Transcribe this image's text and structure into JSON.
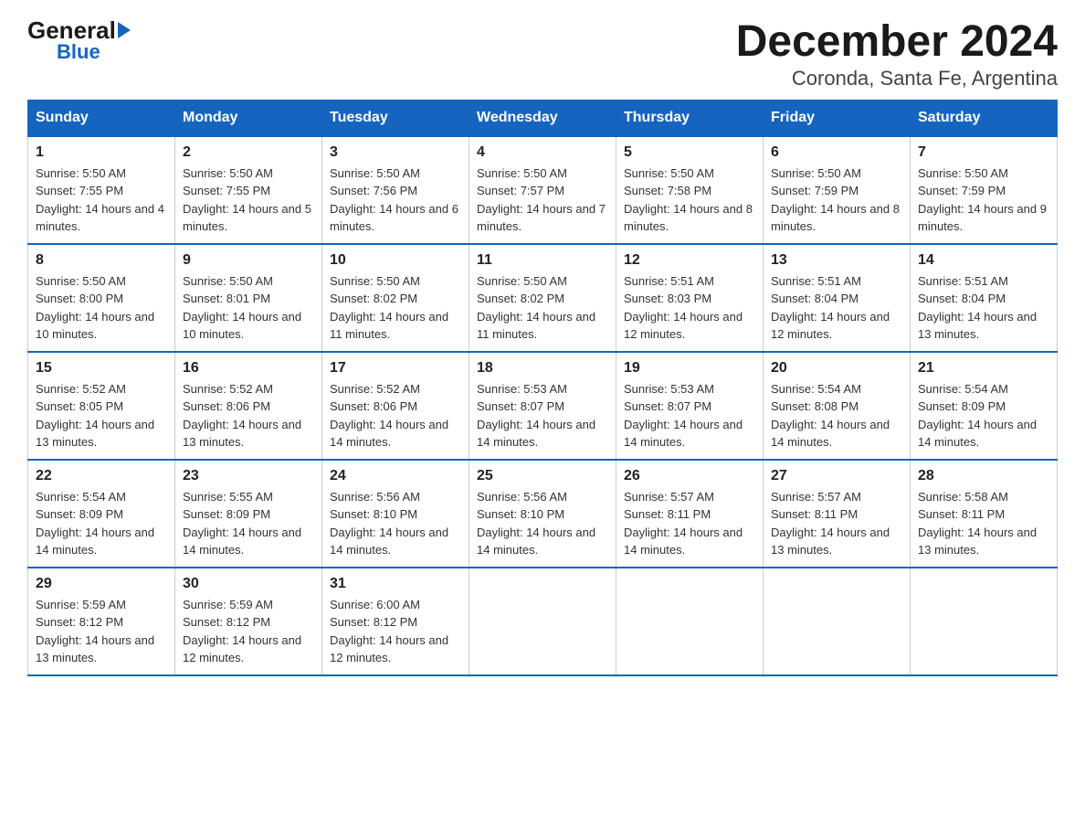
{
  "logo": {
    "general": "General",
    "blue": "Blue",
    "triangle": "▼"
  },
  "title": "December 2024",
  "subtitle": "Coronda, Santa Fe, Argentina",
  "days_of_week": [
    "Sunday",
    "Monday",
    "Tuesday",
    "Wednesday",
    "Thursday",
    "Friday",
    "Saturday"
  ],
  "weeks": [
    [
      {
        "num": "1",
        "sunrise": "5:50 AM",
        "sunset": "7:55 PM",
        "daylight": "14 hours and 4 minutes."
      },
      {
        "num": "2",
        "sunrise": "5:50 AM",
        "sunset": "7:55 PM",
        "daylight": "14 hours and 5 minutes."
      },
      {
        "num": "3",
        "sunrise": "5:50 AM",
        "sunset": "7:56 PM",
        "daylight": "14 hours and 6 minutes."
      },
      {
        "num": "4",
        "sunrise": "5:50 AM",
        "sunset": "7:57 PM",
        "daylight": "14 hours and 7 minutes."
      },
      {
        "num": "5",
        "sunrise": "5:50 AM",
        "sunset": "7:58 PM",
        "daylight": "14 hours and 8 minutes."
      },
      {
        "num": "6",
        "sunrise": "5:50 AM",
        "sunset": "7:59 PM",
        "daylight": "14 hours and 8 minutes."
      },
      {
        "num": "7",
        "sunrise": "5:50 AM",
        "sunset": "7:59 PM",
        "daylight": "14 hours and 9 minutes."
      }
    ],
    [
      {
        "num": "8",
        "sunrise": "5:50 AM",
        "sunset": "8:00 PM",
        "daylight": "14 hours and 10 minutes."
      },
      {
        "num": "9",
        "sunrise": "5:50 AM",
        "sunset": "8:01 PM",
        "daylight": "14 hours and 10 minutes."
      },
      {
        "num": "10",
        "sunrise": "5:50 AM",
        "sunset": "8:02 PM",
        "daylight": "14 hours and 11 minutes."
      },
      {
        "num": "11",
        "sunrise": "5:50 AM",
        "sunset": "8:02 PM",
        "daylight": "14 hours and 11 minutes."
      },
      {
        "num": "12",
        "sunrise": "5:51 AM",
        "sunset": "8:03 PM",
        "daylight": "14 hours and 12 minutes."
      },
      {
        "num": "13",
        "sunrise": "5:51 AM",
        "sunset": "8:04 PM",
        "daylight": "14 hours and 12 minutes."
      },
      {
        "num": "14",
        "sunrise": "5:51 AM",
        "sunset": "8:04 PM",
        "daylight": "14 hours and 13 minutes."
      }
    ],
    [
      {
        "num": "15",
        "sunrise": "5:52 AM",
        "sunset": "8:05 PM",
        "daylight": "14 hours and 13 minutes."
      },
      {
        "num": "16",
        "sunrise": "5:52 AM",
        "sunset": "8:06 PM",
        "daylight": "14 hours and 13 minutes."
      },
      {
        "num": "17",
        "sunrise": "5:52 AM",
        "sunset": "8:06 PM",
        "daylight": "14 hours and 14 minutes."
      },
      {
        "num": "18",
        "sunrise": "5:53 AM",
        "sunset": "8:07 PM",
        "daylight": "14 hours and 14 minutes."
      },
      {
        "num": "19",
        "sunrise": "5:53 AM",
        "sunset": "8:07 PM",
        "daylight": "14 hours and 14 minutes."
      },
      {
        "num": "20",
        "sunrise": "5:54 AM",
        "sunset": "8:08 PM",
        "daylight": "14 hours and 14 minutes."
      },
      {
        "num": "21",
        "sunrise": "5:54 AM",
        "sunset": "8:09 PM",
        "daylight": "14 hours and 14 minutes."
      }
    ],
    [
      {
        "num": "22",
        "sunrise": "5:54 AM",
        "sunset": "8:09 PM",
        "daylight": "14 hours and 14 minutes."
      },
      {
        "num": "23",
        "sunrise": "5:55 AM",
        "sunset": "8:09 PM",
        "daylight": "14 hours and 14 minutes."
      },
      {
        "num": "24",
        "sunrise": "5:56 AM",
        "sunset": "8:10 PM",
        "daylight": "14 hours and 14 minutes."
      },
      {
        "num": "25",
        "sunrise": "5:56 AM",
        "sunset": "8:10 PM",
        "daylight": "14 hours and 14 minutes."
      },
      {
        "num": "26",
        "sunrise": "5:57 AM",
        "sunset": "8:11 PM",
        "daylight": "14 hours and 14 minutes."
      },
      {
        "num": "27",
        "sunrise": "5:57 AM",
        "sunset": "8:11 PM",
        "daylight": "14 hours and 13 minutes."
      },
      {
        "num": "28",
        "sunrise": "5:58 AM",
        "sunset": "8:11 PM",
        "daylight": "14 hours and 13 minutes."
      }
    ],
    [
      {
        "num": "29",
        "sunrise": "5:59 AM",
        "sunset": "8:12 PM",
        "daylight": "14 hours and 13 minutes."
      },
      {
        "num": "30",
        "sunrise": "5:59 AM",
        "sunset": "8:12 PM",
        "daylight": "14 hours and 12 minutes."
      },
      {
        "num": "31",
        "sunrise": "6:00 AM",
        "sunset": "8:12 PM",
        "daylight": "14 hours and 12 minutes."
      },
      null,
      null,
      null,
      null
    ]
  ],
  "sunrise_label": "Sunrise:",
  "sunset_label": "Sunset:",
  "daylight_label": "Daylight:"
}
